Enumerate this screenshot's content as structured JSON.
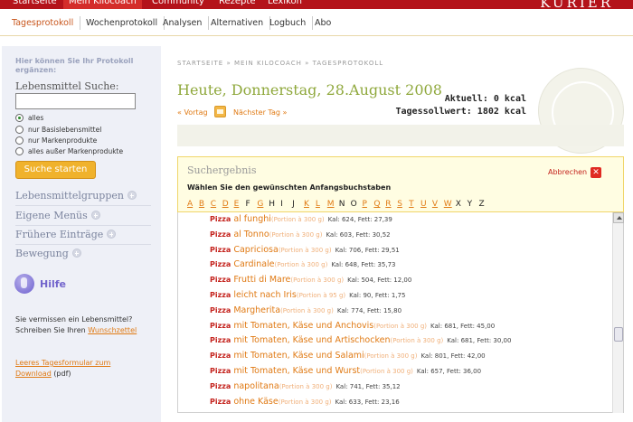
{
  "topnav": {
    "tabs": [
      {
        "label": "Startseite"
      },
      {
        "label": "Mein Kilocoach"
      },
      {
        "label": "Community"
      },
      {
        "label": "Rezepte"
      },
      {
        "label": "Lexikon"
      }
    ],
    "logo": "KURIER"
  },
  "subnav": {
    "items": [
      {
        "label": "Tagesprotokoll"
      },
      {
        "label": "Wochenprotokoll"
      },
      {
        "label": "Analysen"
      },
      {
        "label": "Alternativen"
      },
      {
        "label": "Logbuch"
      },
      {
        "label": "Abo"
      }
    ]
  },
  "sidebar": {
    "hint": "Hier können Sie Ihr Protokoll ergänzen:",
    "search_label": "Lebensmittel Suche:",
    "search_value": "",
    "radios": [
      {
        "label": "alles",
        "checked": true
      },
      {
        "label": "nur Basislebensmittel",
        "checked": false
      },
      {
        "label": "nur Markenprodukte",
        "checked": false
      },
      {
        "label": "alles außer Markenprodukte",
        "checked": false
      }
    ],
    "search_button": "Suche starten",
    "links": [
      {
        "label": "Lebensmittelgruppen"
      },
      {
        "label": "Eigene Menüs"
      },
      {
        "label": "Frühere Einträge"
      },
      {
        "label": "Bewegung"
      }
    ],
    "help": "Hilfe",
    "missing_text": "Sie vermissen ein Lebensmittel? Schreiben Sie Ihren",
    "missing_link": "Wunschzettel",
    "form_link": "Leeres Tagesformular zum Download",
    "form_suffix": "(pdf)"
  },
  "main": {
    "breadcrumb": "STARTSEITE » MEIN KILOCOACH » TAGESPROTOKOLL",
    "title": "Heute, Donnerstag, 28.August 2008",
    "prev": "« Vortag",
    "next": "Nächster Tag »",
    "current_kcal": "Aktuell: 0 kcal",
    "target_kcal": "Tagessollwert: 1802 kcal"
  },
  "results": {
    "title": "Suchergebnis",
    "subtitle": "Wählen Sie den gewünschten Anfangsbuchstaben",
    "cancel": "Abbrechen",
    "alphabet": [
      {
        "l": "A",
        "link": true
      },
      {
        "l": "B",
        "link": true
      },
      {
        "l": "C",
        "link": true
      },
      {
        "l": "D",
        "link": true
      },
      {
        "l": "E",
        "link": true
      },
      {
        "l": "F",
        "link": false
      },
      {
        "l": "G",
        "link": true
      },
      {
        "l": "H",
        "link": false
      },
      {
        "l": "I",
        "link": false
      },
      {
        "l": "J",
        "link": false
      },
      {
        "l": "K",
        "link": true
      },
      {
        "l": "L",
        "link": true
      },
      {
        "l": "M",
        "link": true
      },
      {
        "l": "N",
        "link": false
      },
      {
        "l": "O",
        "link": false
      },
      {
        "l": "P",
        "link": true
      },
      {
        "l": "Q",
        "link": true
      },
      {
        "l": "R",
        "link": true
      },
      {
        "l": "S",
        "link": true
      },
      {
        "l": "T",
        "link": true
      },
      {
        "l": "U",
        "link": true
      },
      {
        "l": "V",
        "link": true
      },
      {
        "l": "W",
        "link": true
      },
      {
        "l": "X",
        "link": false
      },
      {
        "l": "Y",
        "link": false
      },
      {
        "l": "Z",
        "link": false
      }
    ],
    "items": [
      {
        "name": "Pizza",
        "variant": "al funghi",
        "portion": "(Portion à 300 g)",
        "nutrition": "Kal: 624, Fett: 27,39"
      },
      {
        "name": "Pizza",
        "variant": "al Tonno",
        "portion": "(Portion à 300 g)",
        "nutrition": "Kal: 603, Fett: 30,52"
      },
      {
        "name": "Pizza",
        "variant": "Capriciosa",
        "portion": "(Portion à 300 g)",
        "nutrition": "Kal: 706, Fett: 29,51"
      },
      {
        "name": "Pizza",
        "variant": "Cardinale",
        "portion": "(Portion à 300 g)",
        "nutrition": "Kal: 648, Fett: 35,73"
      },
      {
        "name": "Pizza",
        "variant": "Frutti di Mare",
        "portion": "(Portion à 300 g)",
        "nutrition": "Kal: 504, Fett: 12,00"
      },
      {
        "name": "Pizza",
        "variant": "leicht nach Iris",
        "portion": "(Portion à 95 g)",
        "nutrition": "Kal: 90, Fett: 1,75"
      },
      {
        "name": "Pizza",
        "variant": "Margherita",
        "portion": "(Portion à 300 g)",
        "nutrition": "Kal: 774, Fett: 15,80"
      },
      {
        "name": "Pizza",
        "variant": "mit Tomaten, Käse und Anchovis",
        "portion": "(Portion à 300 g)",
        "nutrition": "Kal: 681, Fett: 45,00"
      },
      {
        "name": "Pizza",
        "variant": "mit Tomaten, Käse und Artischocken",
        "portion": "(Portion à 300 g)",
        "nutrition": "Kal: 681, Fett: 30,00"
      },
      {
        "name": "Pizza",
        "variant": "mit Tomaten, Käse und Salami",
        "portion": "(Portion à 300 g)",
        "nutrition": "Kal: 801, Fett: 42,00"
      },
      {
        "name": "Pizza",
        "variant": "mit Tomaten, Käse und Wurst",
        "portion": "(Portion à 300 g)",
        "nutrition": "Kal: 657, Fett: 36,00"
      },
      {
        "name": "Pizza",
        "variant": "napolitana",
        "portion": "(Portion à 300 g)",
        "nutrition": "Kal: 741, Fett: 35,12"
      },
      {
        "name": "Pizza",
        "variant": "ohne Käse",
        "portion": "(Portion à 300 g)",
        "nutrition": "Kal: 633, Fett: 23,16"
      }
    ]
  }
}
